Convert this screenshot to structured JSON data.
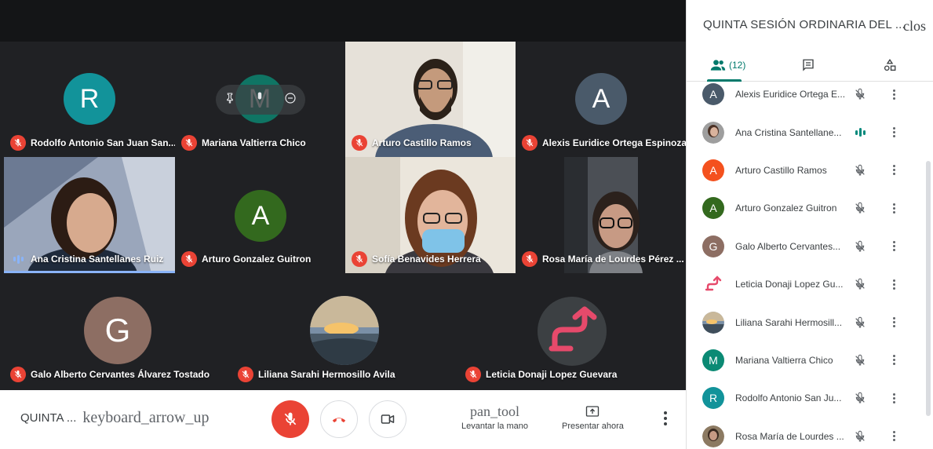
{
  "meeting": {
    "title_short": "QUINTA ...",
    "expand_icon_text": "keyboard_arrow_up"
  },
  "tiles": [
    {
      "name": "Rodolfo Antonio San Juan San...",
      "initial": "R",
      "color": "#12939a",
      "mic": "muted"
    },
    {
      "name": "Mariana Valtierra Chico",
      "initial": "M",
      "color": "#0b8a74",
      "mic": "muted"
    },
    {
      "name": "Arturo Castillo Ramos",
      "mic": "muted"
    },
    {
      "name": "Alexis Euridice Ortega Espinoza",
      "initial": "A",
      "color": "#4a5a6a",
      "mic": "muted"
    },
    {
      "name": "Ana Cristina Santellanes Ruiz",
      "mic": "speaking"
    },
    {
      "name": "Arturo Gonzalez Guitron",
      "initial": "A",
      "color": "#33691e",
      "mic": "muted"
    },
    {
      "name": "Sofía Benavides Herrera",
      "mic": "muted"
    },
    {
      "name": "Rosa María de Lourdes Pérez ...",
      "mic": "muted"
    },
    {
      "name": "Galo Alberto Cervantes Álvarez Tostado",
      "initial": "G",
      "color": "#8d6e63",
      "mic": "muted"
    },
    {
      "name": "Liliana Sarahi Hermosillo Avila",
      "mic": "muted"
    },
    {
      "name": "Leticia Donaji Lopez Guevara",
      "mic": "muted"
    }
  ],
  "controls": {
    "mic": "muted",
    "hand_icon_text": "pan_tool",
    "hand_label": "Levantar la mano",
    "present_label": "Presentar ahora"
  },
  "panel": {
    "title": "QUINTA SESIÓN ORDINARIA DEL ...",
    "close_icon_text": "clos",
    "people_count": "(12)",
    "accent": "#00796b",
    "participants": [
      {
        "name": "Alexis Euridice Ortega E...",
        "initial": "A",
        "color": "#4a5a6a",
        "mic": "muted"
      },
      {
        "name": "Ana Cristina Santellane...",
        "mic": "speaking"
      },
      {
        "name": "Arturo Castillo Ramos",
        "initial": "A",
        "color": "#f4511e",
        "mic": "muted"
      },
      {
        "name": "Arturo Gonzalez Guitron",
        "initial": "A",
        "color": "#33691e",
        "mic": "muted"
      },
      {
        "name": "Galo Alberto Cervantes...",
        "initial": "G",
        "color": "#8d6e63",
        "mic": "muted"
      },
      {
        "name": "Leticia Donaji Lopez Gu...",
        "mic": "muted"
      },
      {
        "name": "Liliana Sarahi Hermosill...",
        "mic": "muted"
      },
      {
        "name": "Mariana Valtierra Chico",
        "initial": "M",
        "color": "#0b8a74",
        "mic": "muted"
      },
      {
        "name": "Rodolfo Antonio San Ju...",
        "initial": "R",
        "color": "#12939a",
        "mic": "muted"
      },
      {
        "name": "Rosa María de Lourdes ...",
        "mic": "muted"
      }
    ]
  },
  "colors": {
    "stage_bg": "#202124",
    "mute_red": "#ea4335",
    "speaking_blue": "#8ab4f8"
  }
}
